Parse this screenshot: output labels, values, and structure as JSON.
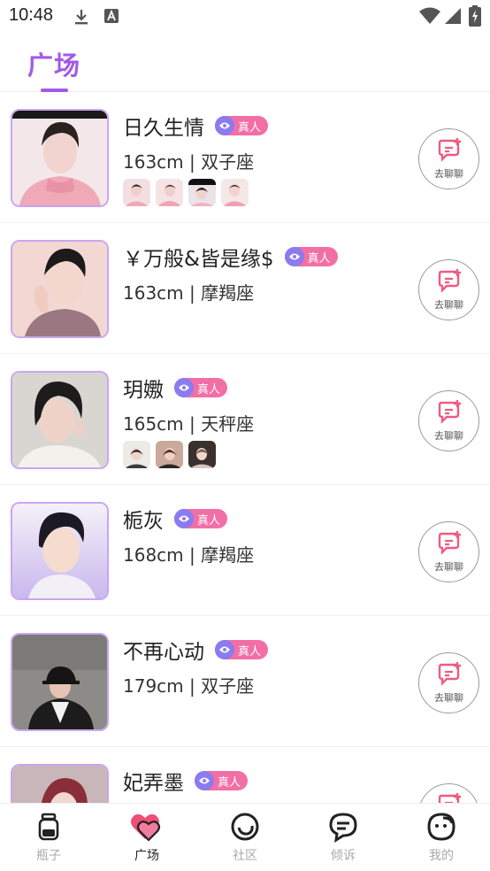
{
  "status_bar": {
    "time": "10:48"
  },
  "header": {
    "tab_label": "广场"
  },
  "badge_label": "真人",
  "chat_label": "去聊聊",
  "users": [
    {
      "name": "日久生情",
      "meta": "163cm | 双子座"
    },
    {
      "name": "￥万般&皆是缘$",
      "meta": "163cm | 摩羯座"
    },
    {
      "name": "玥嫐",
      "meta": "165cm | 天秤座"
    },
    {
      "name": "栀灰",
      "meta": "168cm | 摩羯座"
    },
    {
      "name": "不再心动",
      "meta": "179cm | 双子座"
    },
    {
      "name": "妃弄墨",
      "meta": ""
    }
  ],
  "bottom_nav": [
    {
      "label": "瓶子",
      "icon": "bottle-icon"
    },
    {
      "label": "广场",
      "icon": "heart-square-icon",
      "active": true
    },
    {
      "label": "社区",
      "icon": "community-icon"
    },
    {
      "label": "倾诉",
      "icon": "chat-bubble-icon"
    },
    {
      "label": "我的",
      "icon": "face-icon"
    }
  ],
  "colors": {
    "accent": "#a05be6",
    "badge_pink": "#f26fa6",
    "badge_eye": "#8a7bf0",
    "chat_icon": "#ef5b7f"
  }
}
